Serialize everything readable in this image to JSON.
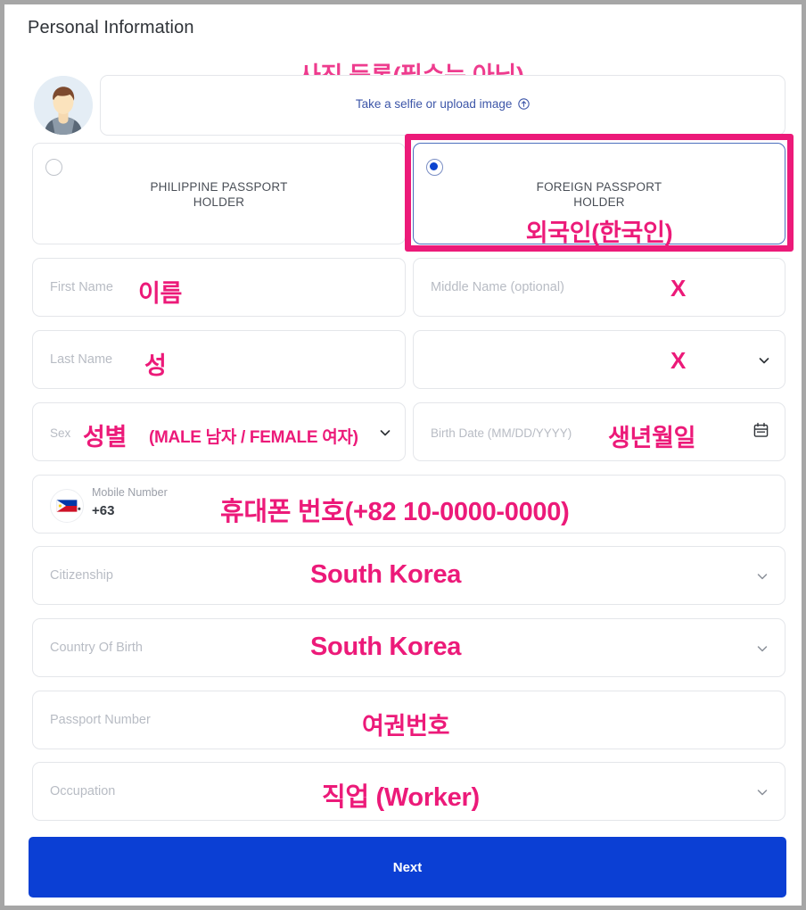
{
  "header": {
    "title": "Personal Information"
  },
  "photo": {
    "annotation": "사진 등록(필수는 아님)",
    "upload_label": "Take a selfie or upload image",
    "upload_icon": "upload-circle-icon",
    "avatar_icon": "avatar-person-icon"
  },
  "passport_type": {
    "options": [
      {
        "label": "PHILIPPINE PASSPORT HOLDER",
        "label_line1": "PHILIPPINE PASSPORT",
        "label_line2": "HOLDER",
        "selected": false
      },
      {
        "label": "FOREIGN PASSPORT HOLDER",
        "label_line1": "FOREIGN PASSPORT",
        "label_line2": "HOLDER",
        "selected": true,
        "annotation": "외국인(한국인)"
      }
    ]
  },
  "fields": {
    "first_name": {
      "placeholder": "First Name",
      "value": "",
      "annotation": "이름"
    },
    "middle_name": {
      "placeholder": "Middle Name (optional)",
      "value": "",
      "annotation": "X"
    },
    "last_name": {
      "placeholder": "Last Name",
      "value": "",
      "annotation": "성"
    },
    "suffix": {
      "placeholder": "",
      "value": "",
      "annotation": "X",
      "icon": "chevron-down-icon"
    },
    "sex": {
      "placeholder": "Sex",
      "value": "",
      "annotation": "성별",
      "annotation_note": "(MALE 남자 / FEMALE 여자)",
      "icon": "chevron-down-icon"
    },
    "birth_date": {
      "placeholder": "Birth Date (MM/DD/YYYY)",
      "value": "",
      "annotation": "생년월일",
      "icon": "calendar-icon"
    },
    "mobile_number": {
      "label": "Mobile Number",
      "country_code": "+63",
      "flag": "philippines-flag-icon",
      "annotation": "휴대폰 번호(+82 10-0000-0000)"
    },
    "citizenship": {
      "placeholder": "Citizenship",
      "value": "",
      "annotation": "South Korea",
      "icon": "chevron-down-icon"
    },
    "country_of_birth": {
      "placeholder": "Country Of Birth",
      "value": "",
      "annotation": "South Korea",
      "icon": "chevron-down-icon"
    },
    "passport_number": {
      "placeholder": "Passport Number",
      "value": "",
      "annotation": "여권번호"
    },
    "occupation": {
      "placeholder": "Occupation",
      "value": "",
      "annotation": "직업 (Worker)",
      "icon": "chevron-down-icon"
    }
  },
  "footer": {
    "next_label": "Next"
  },
  "colors": {
    "annotation_pink": "#ec1a79",
    "annotation_pink_soft": "#ee3c8e",
    "primary_blue": "#0b3fd4",
    "radio_selected_blue": "#0b43cf",
    "link_blue": "#3d56a8",
    "placeholder_gray": "#b8bcc4"
  }
}
